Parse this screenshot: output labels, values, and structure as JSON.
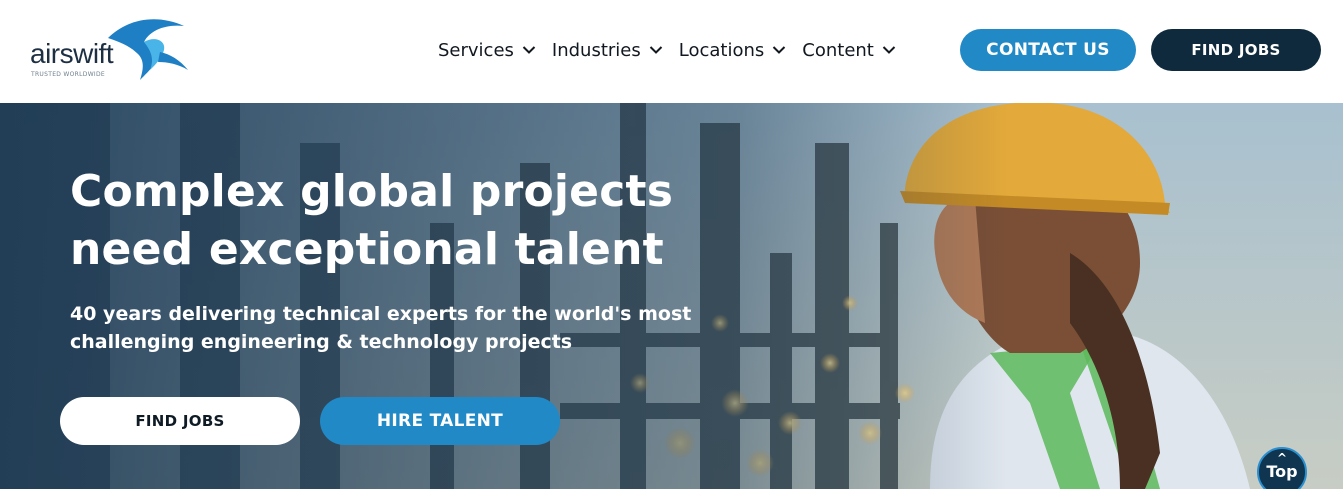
{
  "brand": {
    "name": "airswift",
    "tagline": "TRUSTED WORLDWIDE",
    "colors": {
      "primary": "#2189c6",
      "dark": "#0f2a3d",
      "text": "#111820"
    }
  },
  "nav": {
    "items": [
      {
        "label": "Services",
        "icon": "chevron-down-icon"
      },
      {
        "label": "Industries",
        "icon": "chevron-down-icon"
      },
      {
        "label": "Locations",
        "icon": "chevron-down-icon"
      },
      {
        "label": "Content",
        "icon": "chevron-down-icon"
      }
    ],
    "contact_label": "CONTACT US",
    "find_jobs_label": "FIND JOBS"
  },
  "hero": {
    "title": "Complex global projects need exceptional talent",
    "subtitle": "40 years delivering technical experts for the world's most challenging engineering & technology projects",
    "find_jobs_label": "FIND JOBS",
    "hire_talent_label": "HIRE TALENT",
    "image_description_icon": "refinery-worker-photo"
  },
  "back_to_top": {
    "label": "Top",
    "icon": "caret-up-icon"
  }
}
